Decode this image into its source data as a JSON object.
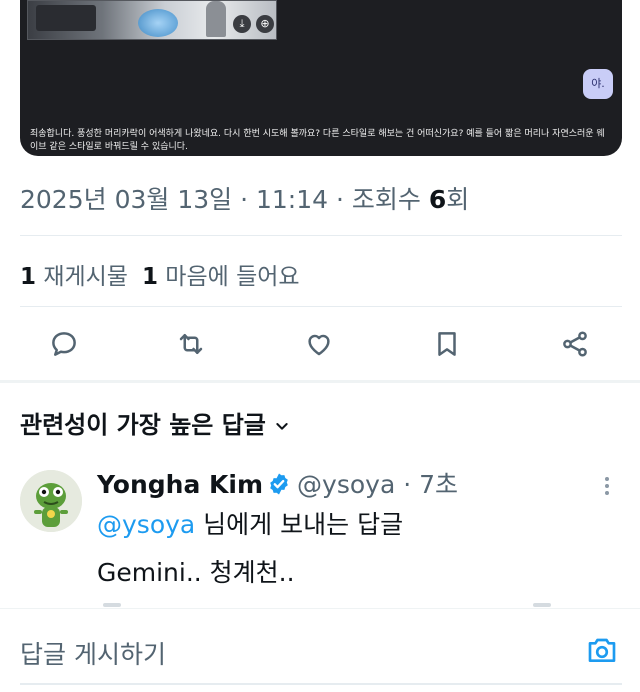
{
  "media": {
    "thumb_btn_download": "⤓",
    "thumb_btn_share": "⊕",
    "bubble_label": "야.",
    "gemini_message": "죄송합니다. 풍성한 머리카락이 어색하게 나왔네요. 다시 한번 시도해 볼까요? 다른 스타일로 해보는 건 어떠신가요? 예를 들어 짧은 머리나 자연스러운 웨이브 같은 스타일로 바꿔드릴 수 있습니다."
  },
  "meta": {
    "date": "2025년 03월 13일",
    "sep1": " · ",
    "time": "11:14",
    "sep2": " · ",
    "views_prefix": "조회수 ",
    "views_count": "6",
    "views_suffix": "회"
  },
  "stats": {
    "reposts_count": "1",
    "reposts_label": " 재게시물",
    "likes_count": "1",
    "likes_label": " 마음에 들어요"
  },
  "actions": [
    "reply-icon",
    "repost-icon",
    "like-icon",
    "bookmark-icon",
    "share-icon"
  ],
  "sort": {
    "label": "관련성이 가장 높은 답글"
  },
  "reply": {
    "name": "Yongha Kim",
    "handle": "@ysoya",
    "dot": " · ",
    "time": "7초",
    "mention": "@ysoya",
    "reply_to_suffix": " 님에게 보내는 답글",
    "text": "Gemini.. 청계천.."
  },
  "composer": {
    "placeholder": "답글 게시하기"
  },
  "colors": {
    "accent": "#1d9bf0",
    "muted": "#536471",
    "text": "#0f1419"
  }
}
